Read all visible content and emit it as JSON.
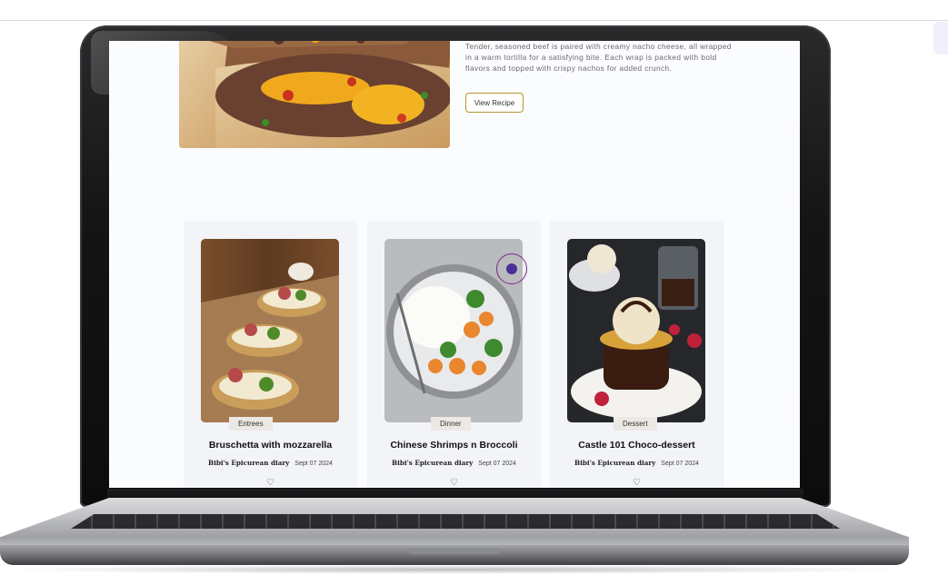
{
  "featured": {
    "description": "Tender, seasoned beef is paired with creamy nacho cheese, all wrapped in a warm tortilla for a satisfying bite. Each wrap is packed with bold flavors and topped with crispy nachos for added crunch.",
    "button_label": "View Recipe"
  },
  "cards": [
    {
      "category": "Entrees",
      "title": "Bruschetta with mozzarella",
      "author": "Bibi's Epicurean diary",
      "date": "Sept 07 2024",
      "like_icon": "heart-icon"
    },
    {
      "category": "Dinner",
      "title": "Chinese Shrimps n Broccoli",
      "author": "Bibi's Epicurean diary",
      "date": "Sept 07 2024",
      "like_icon": "heart-icon"
    },
    {
      "category": "Dessert",
      "title": "Castle 101 Choco-dessert",
      "author": "Bibi's Epicurean diary",
      "date": "Sept 07 2024",
      "like_icon": "heart-icon"
    }
  ],
  "colors": {
    "accent_button_border": "#b7962f",
    "card_background": "#f2f4f8",
    "cursor": "#4b2f9a"
  }
}
